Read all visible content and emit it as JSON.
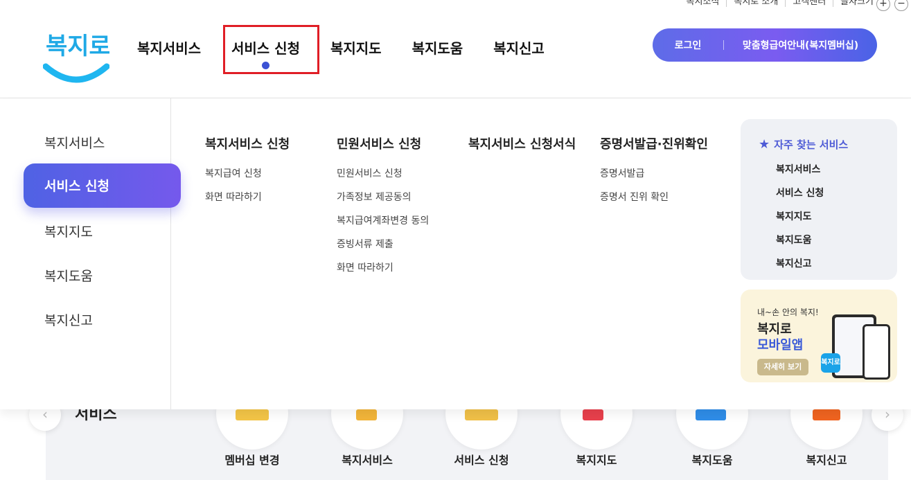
{
  "util": {
    "links": [
      "복지소식",
      "복지로 소개",
      "고객센터",
      "글자크기"
    ],
    "zoom_in": "+",
    "zoom_out": "−"
  },
  "brand": {
    "logo_text": "복지로"
  },
  "gnb": {
    "items": [
      "복지서비스",
      "서비스 신청",
      "복지지도",
      "복지도움",
      "복지신고"
    ],
    "active": "서비스 신청"
  },
  "auth": {
    "login": "로그인",
    "membership": "맞춤형급여안내(복지멤버십)"
  },
  "mega": {
    "side": [
      "복지서비스",
      "서비스 신청",
      "복지지도",
      "복지도움",
      "복지신고"
    ],
    "columns": [
      {
        "title": "복지서비스 신청",
        "items": [
          "복지급여 신청",
          "화면 따라하기"
        ]
      },
      {
        "title": "민원서비스 신청",
        "items": [
          "민원서비스 신청",
          "가족정보 제공동의",
          "복지급여계좌변경 동의",
          "증빙서류 제출",
          "화면 따라하기"
        ]
      },
      {
        "title": "복지서비스 신청서식",
        "items": []
      },
      {
        "title": "증명서발급·진위확인",
        "items": [
          "증명서발급",
          "증명서 진위 확인"
        ]
      }
    ],
    "frequent": {
      "title": "자주 찾는 서비스",
      "items": [
        "복지서비스",
        "서비스 신청",
        "복지지도",
        "복지도움",
        "복지신고"
      ]
    },
    "banner": {
      "line1": "내~손 안의 복지!",
      "line2": "복지로",
      "line3": "모바일앱",
      "button": "자세히 보기"
    }
  },
  "quick": {
    "title": "서비스",
    "items": [
      "멤버십 변경",
      "복지서비스",
      "서비스 신청",
      "복지지도",
      "복지도움",
      "복지신고"
    ],
    "prev": "‹",
    "next": "›"
  },
  "colors": {
    "accent": "#5e6ce8",
    "highlight": "#e01e26"
  }
}
